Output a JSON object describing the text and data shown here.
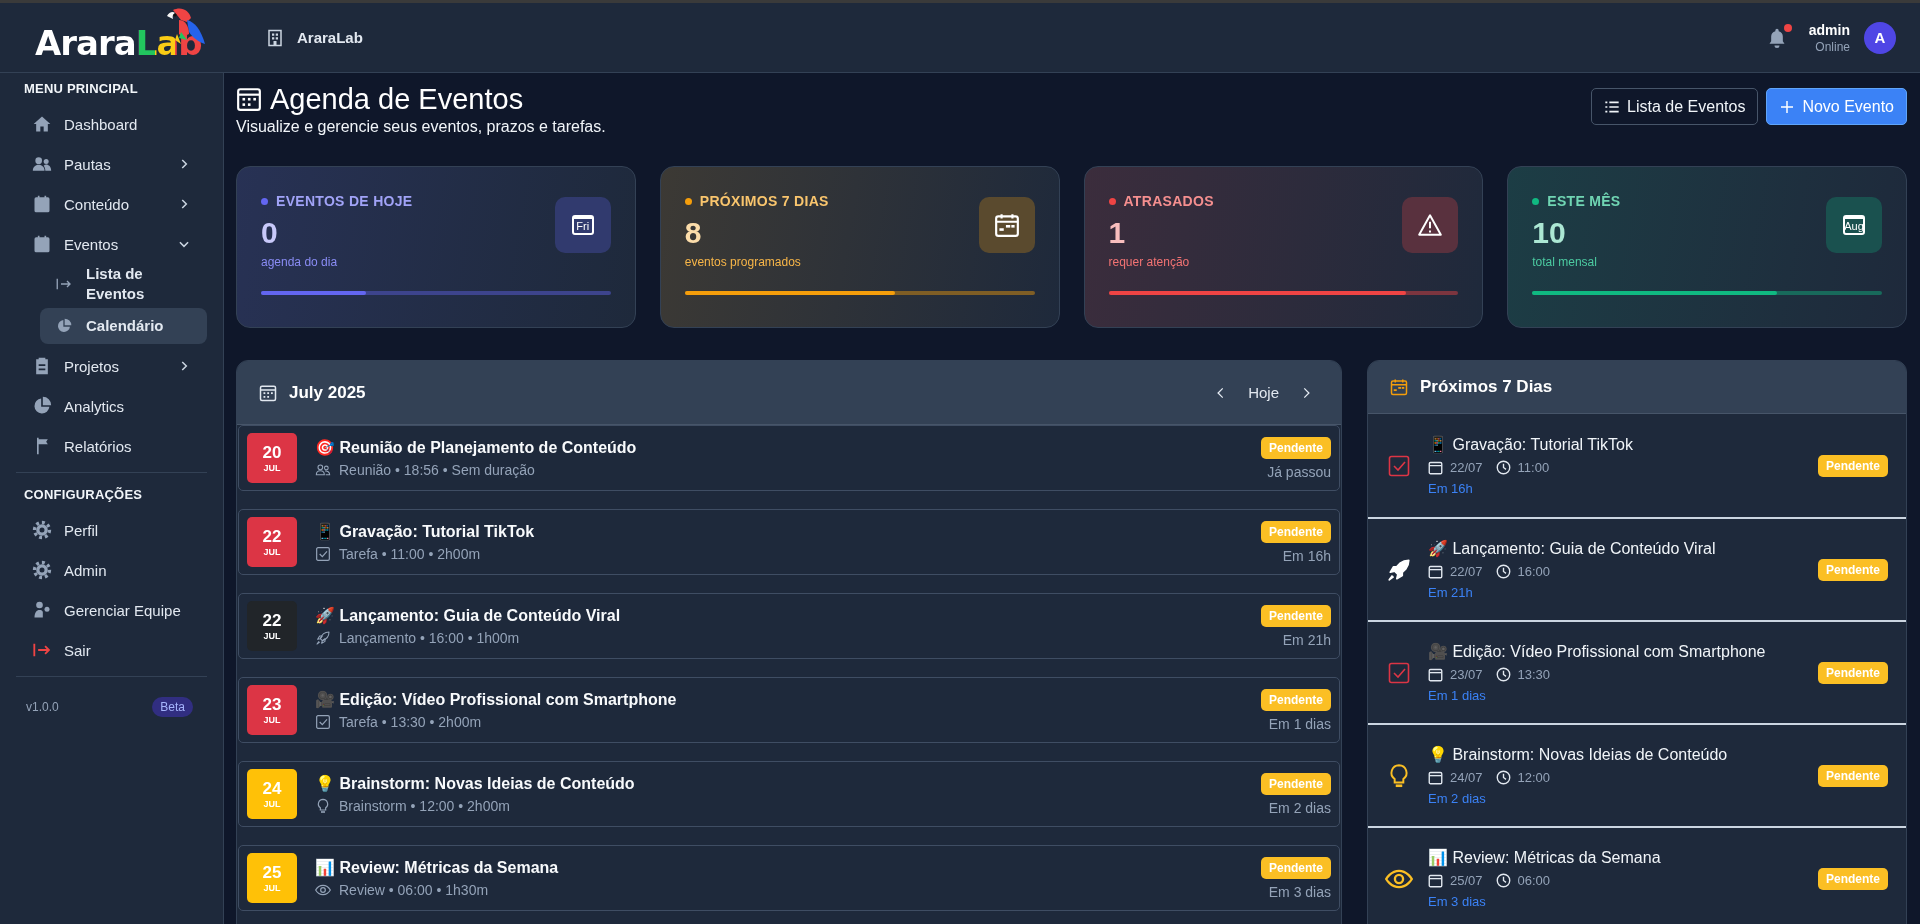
{
  "header": {
    "logo": "AraraLab",
    "organization": "AraraLab",
    "notifications_unread": true,
    "user": {
      "name": "admin",
      "status": "Online",
      "avatar": "A"
    }
  },
  "sidebar": {
    "sections": [
      {
        "title": "MENU PRINCIPAL",
        "items": [
          {
            "label": "Dashboard",
            "selected": false
          },
          {
            "label": "Pautas",
            "selected": false,
            "expanded": false
          },
          {
            "label": "Conteúdo",
            "selected": false,
            "expanded": false
          },
          {
            "label": "Eventos",
            "selected": false,
            "expanded": true,
            "children": [
              {
                "label": "Lista de Eventos",
                "selected": false
              },
              {
                "label": "Calendário",
                "selected": true
              }
            ]
          },
          {
            "label": "Projetos",
            "selected": false,
            "expanded": false
          },
          {
            "label": "Analytics",
            "selected": false
          },
          {
            "label": "Relatórios",
            "selected": false
          }
        ]
      },
      {
        "title": "CONFIGURAÇÕES",
        "items": [
          {
            "label": "Perfil",
            "selected": false
          },
          {
            "label": "Admin",
            "selected": false
          },
          {
            "label": "Gerenciar Equipe",
            "selected": false
          },
          {
            "label": "Sair",
            "selected": false
          }
        ]
      }
    ],
    "version": "v1.0.0",
    "badge": "Beta"
  },
  "page": {
    "title": "Agenda de Eventos",
    "subtitle": "Visualize e gerencie seus eventos, prazos e tarefas.",
    "actions": [
      {
        "label": "Lista de Eventos",
        "kind": "secondary"
      },
      {
        "label": "Novo Evento",
        "kind": "primary"
      }
    ]
  },
  "stats": [
    {
      "label": "EVENTOS DE HOJE",
      "value": "0",
      "caption": "agenda do dia",
      "icon_label": "Fri",
      "color": "#6366f1",
      "level": 0.3
    },
    {
      "label": "PRÓXIMOS 7 DIAS",
      "value": "8",
      "caption": "eventos programados",
      "color": "#f59e0b",
      "level": 0.6
    },
    {
      "label": "ATRASADOS",
      "value": "1",
      "caption": "requer atenção",
      "color": "#ef4444",
      "level": 0.85
    },
    {
      "label": "ESTE MÊS",
      "value": "10",
      "caption": "total mensal",
      "icon_label": "Aug",
      "color": "#10b981",
      "level": 0.7
    }
  ],
  "calendar": {
    "title": "July 2025",
    "today_button": "Hoje",
    "events": [
      {
        "day": "20",
        "month": "JUL",
        "color": "#dc3545",
        "title": "🎯 Reunião de Planejamento de Conteúdo",
        "kind": "meeting",
        "meta": "Reunião • 18:56 • Sem duração",
        "status": "Pendente",
        "relative": "Já passou"
      },
      {
        "day": "22",
        "month": "JUL",
        "color": "#dc3545",
        "title": "📱 Gravação: Tutorial TikTok",
        "kind": "task",
        "meta": "Tarefa • 11:00 • 2h00m",
        "status": "Pendente",
        "relative": "Em 16h"
      },
      {
        "day": "22",
        "month": "JUL",
        "color": "#212529",
        "title": "🚀 Lançamento: Guia de Conteúdo Viral",
        "kind": "launch",
        "meta": "Lançamento • 16:00 • 1h00m",
        "status": "Pendente",
        "relative": "Em 21h"
      },
      {
        "day": "23",
        "month": "JUL",
        "color": "#dc3545",
        "title": "🎥 Edição: Vídeo Profissional com Smartphone",
        "kind": "task",
        "meta": "Tarefa • 13:30 • 2h00m",
        "status": "Pendente",
        "relative": "Em 1 dias"
      },
      {
        "day": "24",
        "month": "JUL",
        "color": "#ffc107",
        "title": "💡 Brainstorm: Novas Ideias de Conteúdo",
        "kind": "brainstorm",
        "meta": "Brainstorm • 12:00 • 2h00m",
        "status": "Pendente",
        "relative": "Em 2 dias"
      },
      {
        "day": "25",
        "month": "JUL",
        "color": "#ffc107",
        "title": "📊 Review: Métricas da Semana",
        "kind": "review",
        "meta": "Review • 06:00 • 1h30m",
        "status": "Pendente",
        "relative": "Em 3 dias"
      }
    ]
  },
  "upcoming": {
    "title": "Próximos 7 Dias",
    "items": [
      {
        "kind": "task",
        "title": "📱 Gravação: Tutorial TikTok",
        "date": "22/07",
        "time": "11:00",
        "relative": "Em 16h",
        "status": "Pendente"
      },
      {
        "kind": "launch",
        "title": "🚀 Lançamento: Guia de Conteúdo Viral",
        "date": "22/07",
        "time": "16:00",
        "relative": "Em 21h",
        "status": "Pendente"
      },
      {
        "kind": "task",
        "title": "🎥 Edição: Vídeo Profissional com Smartphone",
        "date": "23/07",
        "time": "13:30",
        "relative": "Em 1 dias",
        "status": "Pendente"
      },
      {
        "kind": "brainstorm",
        "title": "💡 Brainstorm: Novas Ideias de Conteúdo",
        "date": "24/07",
        "time": "12:00",
        "relative": "Em 2 dias",
        "status": "Pendente"
      },
      {
        "kind": "review",
        "title": "📊 Review: Métricas da Semana",
        "date": "25/07",
        "time": "06:00",
        "relative": "Em 3 dias",
        "status": "Pendente"
      }
    ]
  }
}
